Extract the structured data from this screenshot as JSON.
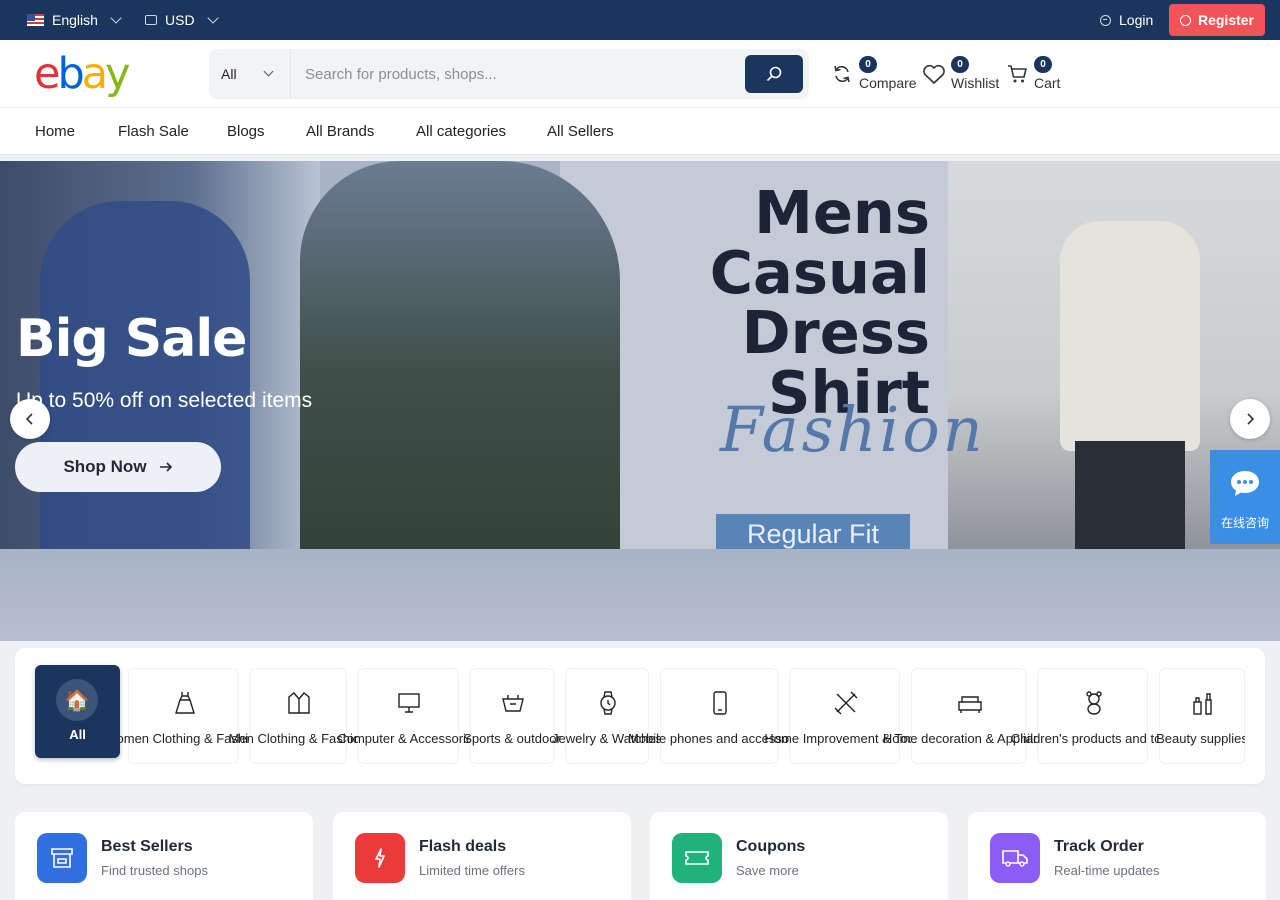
{
  "topbar": {
    "language": "English",
    "currency": "USD",
    "login": "Login",
    "register": "Register"
  },
  "header": {
    "logo": {
      "e": "e",
      "b": "b",
      "a": "a",
      "y": "y"
    },
    "search": {
      "category": "All",
      "placeholder": "Search for products, shops..."
    },
    "compare": {
      "label": "Compare",
      "count": "0"
    },
    "wishlist": {
      "label": "Wishlist",
      "count": "0"
    },
    "cart": {
      "label": "Cart",
      "count": "0"
    }
  },
  "nav": [
    "Home",
    "Flash Sale",
    "Blogs",
    "All Brands",
    "All categories",
    "All Sellers"
  ],
  "hero": {
    "title": "Big Sale",
    "subtitle": "Up to 50% off on selected items",
    "button": "Shop Now",
    "banner_title_1": "Mens",
    "banner_title_2": "Casual",
    "banner_title_3": "Dress Shirt",
    "banner_script": "Fashion",
    "banner_fit": "Regular Fit"
  },
  "chat": {
    "label": "在线咨询"
  },
  "categories": {
    "all": "All",
    "items": [
      "Women Clothing & Fashion",
      "Men Clothing & Fashion",
      "Computer & Accessories",
      "Sports & outdoor",
      "Jewelry & Watches",
      "Mobile phones and accessories",
      "Home Improvement & Tools",
      "Home decoration & Appliance",
      "Children's products and toys",
      "Beauty supplies"
    ]
  },
  "features": [
    {
      "title": "Best Sellers",
      "subtitle": "Find trusted shops",
      "color": "#2f6fe0"
    },
    {
      "title": "Flash deals",
      "subtitle": "Limited time offers",
      "color": "#ea3b3b"
    },
    {
      "title": "Coupons",
      "subtitle": "Save more",
      "color": "#1fb27a"
    },
    {
      "title": "Track Order",
      "subtitle": "Real-time updates",
      "color": "#8b5cf6"
    }
  ],
  "colors": {
    "primary": "#1b365d",
    "accent": "#f05459"
  }
}
